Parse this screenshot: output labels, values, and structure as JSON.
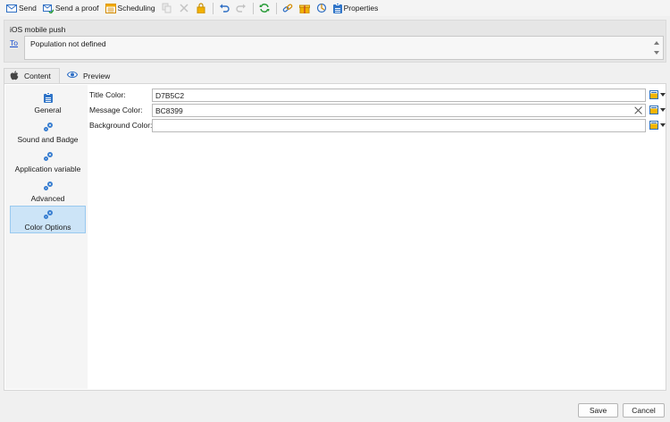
{
  "toolbar": {
    "send_label": "Send",
    "proof_label": "Send a proof",
    "scheduling_label": "Scheduling",
    "properties_label": "Properties"
  },
  "header": {
    "title": "iOS mobile push",
    "to_label": "To",
    "to_value": "Population not defined"
  },
  "tabs": [
    {
      "label": "Content",
      "icon": "apple-icon"
    },
    {
      "label": "Preview",
      "icon": "eye-icon"
    }
  ],
  "sidebar": {
    "items": [
      {
        "label": "General",
        "icon": "clipboard-icon"
      },
      {
        "label": "Sound and Badge",
        "icon": "gears-icon"
      },
      {
        "label": "Application variable",
        "icon": "gears-icon"
      },
      {
        "label": "Advanced",
        "icon": "gears-icon"
      },
      {
        "label": "Color Options",
        "icon": "gears-icon",
        "selected": true
      }
    ]
  },
  "form": {
    "title_color": {
      "label": "Title Color:",
      "value": "D7B5C2"
    },
    "message_color": {
      "label": "Message Color:",
      "value": "BC8399"
    },
    "background_color": {
      "label": "Background Color:",
      "value": ""
    }
  },
  "footer": {
    "save_label": "Save",
    "cancel_label": "Cancel"
  },
  "colors": {
    "accent": "#3a7fd1",
    "selection_bg": "#cce4f7",
    "link": "#1a4fcf"
  }
}
